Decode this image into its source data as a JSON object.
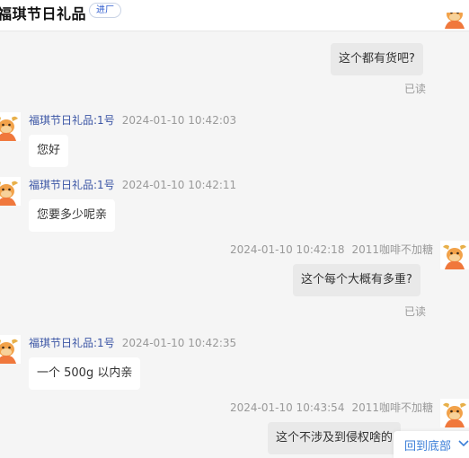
{
  "header": {
    "shop_name": "福琪节日礼品",
    "enter_shop_label": "进厂"
  },
  "messages": [
    {
      "side": "right",
      "text": "这个都有货吧?",
      "read_status": "已读"
    },
    {
      "side": "left",
      "sender": "福琪节日礼品:1号",
      "time": "2024-01-10 10:42:03",
      "text": "您好"
    },
    {
      "side": "left",
      "sender": "福琪节日礼品:1号",
      "time": "2024-01-10 10:42:11",
      "text": "您要多少呢亲"
    },
    {
      "side": "right",
      "sender": "2011咖啡不加糖",
      "time": "2024-01-10 10:42:18",
      "text": "这个每个大概有多重?",
      "read_status": "已读"
    },
    {
      "side": "left",
      "sender": "福琪节日礼品:1号",
      "time": "2024-01-10 10:42:35",
      "text": "一个 500g  以内亲"
    },
    {
      "side": "right",
      "sender": "2011咖啡不加糖",
      "time": "2024-01-10 10:43:54",
      "text": "这个不涉及到侵权啥的"
    }
  ],
  "back_to_bottom_label": "回到底部",
  "colors": {
    "accent_blue": "#3c7fd8",
    "sender_name": "#3b55a5",
    "avatar_orange": "#f0783c"
  }
}
